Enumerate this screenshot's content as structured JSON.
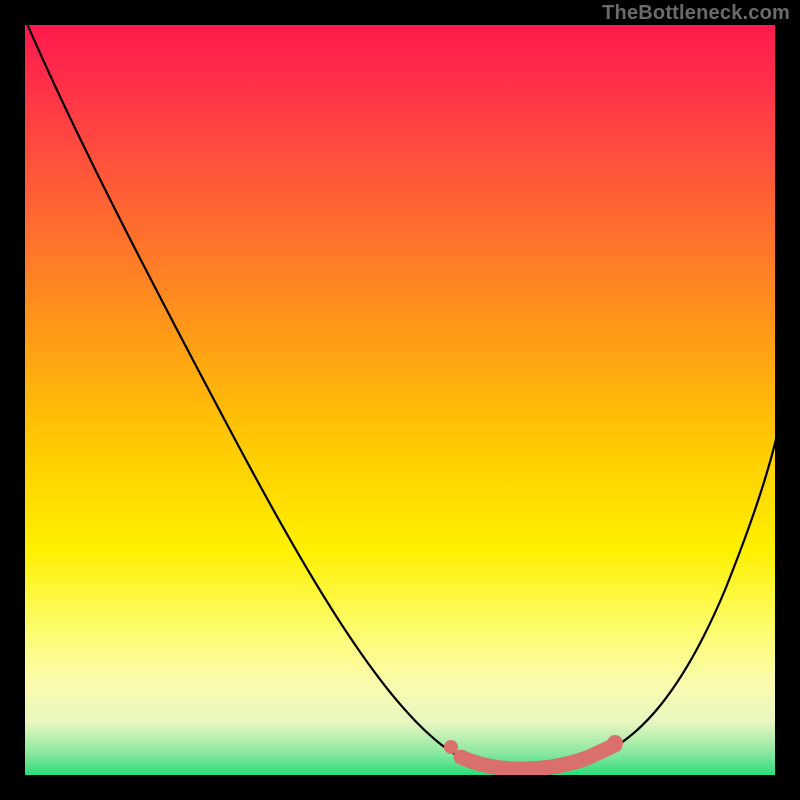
{
  "watermark": "TheBottleneck.com",
  "chart_data": {
    "type": "line",
    "title": "",
    "xlabel": "",
    "ylabel": "",
    "xlim": [
      0,
      100
    ],
    "ylim": [
      0,
      100
    ],
    "series": [
      {
        "name": "curve",
        "x": [
          0,
          9,
          18,
          27,
          36,
          45,
          54,
          58,
          62,
          66,
          70,
          74,
          78,
          82,
          86,
          90,
          94,
          98,
          100
        ],
        "values": [
          100,
          86,
          73,
          60,
          47,
          34,
          20,
          12,
          6,
          3,
          2,
          2,
          2,
          3,
          7,
          14,
          24,
          36,
          42
        ]
      }
    ],
    "annotations": {
      "optimal_band": {
        "x_start": 58,
        "x_end": 80,
        "y": 2
      }
    },
    "background_gradient": {
      "direction": "top-to-bottom",
      "stops": [
        {
          "pos": 0.0,
          "color": "#ff1a4d"
        },
        {
          "pos": 0.25,
          "color": "#ff6a30"
        },
        {
          "pos": 0.5,
          "color": "#ffc400"
        },
        {
          "pos": 0.75,
          "color": "#fff000"
        },
        {
          "pos": 1.0,
          "color": "#2bdc7a"
        }
      ]
    }
  }
}
